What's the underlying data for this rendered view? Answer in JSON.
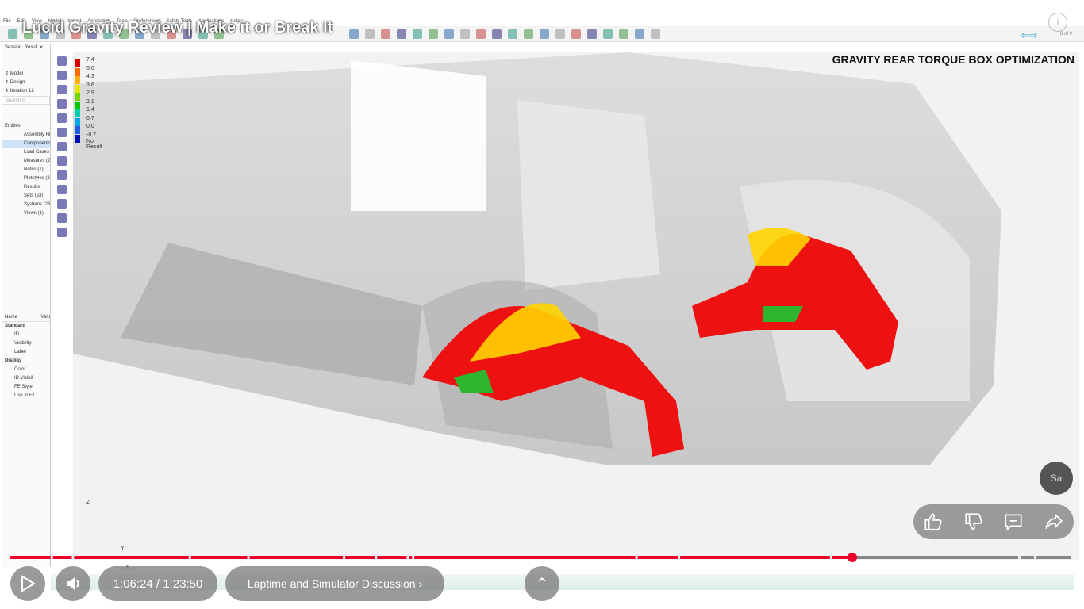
{
  "video": {
    "title": "Lucid Gravity Review | Make it or Break It",
    "overlay_heading": "GRAVITY REAR TORQUE BOX OPTIMIZATION",
    "current_time": "1:06:24",
    "duration": "1:23:50",
    "time_separator": " / ",
    "chapter": "Laptime and Simulator Discussion",
    "chapter_chevron": "›",
    "progress_fraction": 0.792,
    "accent_color": "#e8002d",
    "channel_avatar_text": "Sa",
    "actions": [
      "like-icon",
      "dislike-icon",
      "comment-icon",
      "share-icon"
    ]
  },
  "app": {
    "menu": [
      "File",
      "Edit",
      "View",
      "Model",
      "Import",
      "Annotation",
      "Tools",
      "Preferences",
      "Safety Tools",
      "Applications",
      "Help"
    ],
    "page_count": "8 of 9",
    "panel": {
      "tabs": [
        "Session",
        "Result"
      ],
      "dropdowns": [
        "Model",
        "Design",
        "Iteration 12"
      ],
      "search_placeholder": "Search",
      "entities_label": "Entities",
      "entities": [
        "Assembly Hi",
        "Components",
        "Load Cases",
        "Measures (2",
        "Notes (1)",
        "Plotstyles (3",
        "Results",
        "Sets (53)",
        "Systems (26",
        "Views (1)"
      ],
      "prop_headers": [
        "Name",
        "Valu"
      ],
      "standard_label": "Standard",
      "standard_props": [
        "ID",
        "Visibility",
        "Label"
      ],
      "display_label": "Display",
      "display_props": [
        "Color",
        "ID Visibil",
        "FE Style",
        "Use In Fil"
      ]
    },
    "legend": {
      "values": [
        "7.4",
        "5.0",
        "4.3",
        "3.6",
        "2.9",
        "2.1",
        "1.4",
        "0.7",
        "0.0",
        "-0.7"
      ],
      "colors": [
        "#d40000",
        "#ff6a00",
        "#ffb000",
        "#e8e800",
        "#7ad400",
        "#00c800",
        "#00d0b0",
        "#00a8e8",
        "#2060e0",
        "#0010b0"
      ],
      "no_result": "No Result"
    },
    "axis_labels": [
      "Z",
      "Y",
      "X"
    ]
  }
}
